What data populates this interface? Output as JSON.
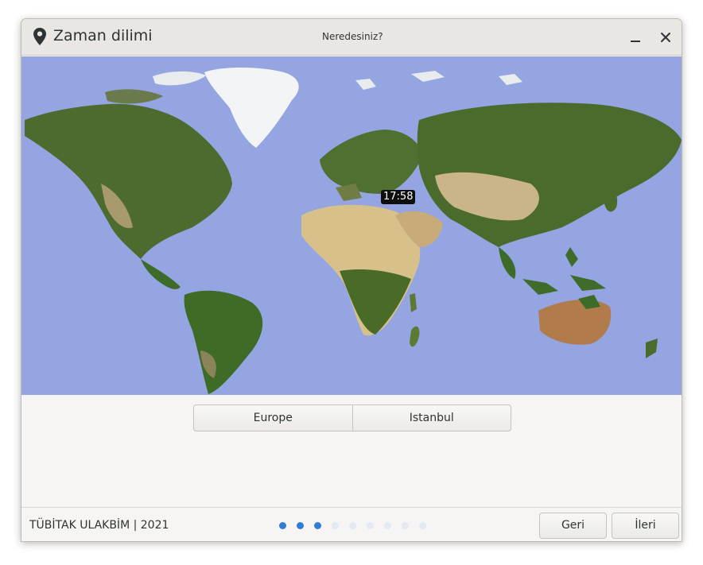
{
  "window": {
    "title": "Zaman dilimi",
    "subtitle": "Neredesiniz?",
    "app_icon": "location-pin-icon",
    "minimize_icon": "minimize-icon",
    "close_icon": "close-icon"
  },
  "map": {
    "time": "17:58",
    "ocean_color": "#94a5e1"
  },
  "timezone": {
    "region": "Europe",
    "city": "Istanbul"
  },
  "footer": {
    "credit": "TÜBİTAK ULAKBİM | 2021",
    "progress": {
      "total_steps": 9,
      "current_step": 3
    },
    "back_label": "Geri",
    "next_label": "İleri"
  },
  "colors": {
    "accent": "#2f7dd6",
    "text": "#2e3436"
  }
}
